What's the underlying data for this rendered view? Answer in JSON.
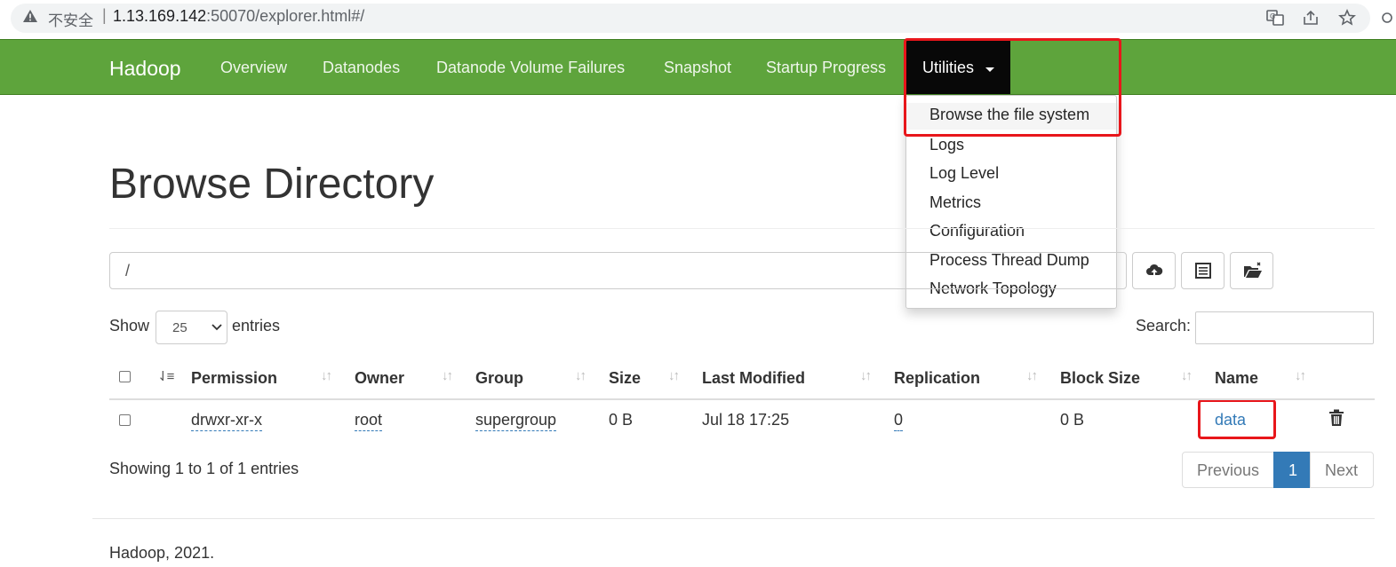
{
  "browser": {
    "insecure_label": "不安全",
    "separator": "|",
    "url_host": "1.13.169.142",
    "url_rest": ":50070/explorer.html#/"
  },
  "navbar": {
    "brand": "Hadoop",
    "items": [
      "Overview",
      "Datanodes",
      "Datanode Volume Failures",
      "Snapshot",
      "Startup Progress"
    ],
    "utilities_label": "Utilities"
  },
  "dropdown": {
    "items": [
      "Browse the file system",
      "Logs",
      "Log Level",
      "Metrics",
      "Configuration",
      "Process Thread Dump",
      "Network Topology"
    ]
  },
  "page": {
    "title": "Browse Directory",
    "path_value": "/",
    "show_label": "Show",
    "entries_select": "25",
    "entries_label": "entries",
    "search_label": "Search:"
  },
  "table": {
    "headers": [
      "Permission",
      "Owner",
      "Group",
      "Size",
      "Last Modified",
      "Replication",
      "Block Size",
      "Name"
    ],
    "rows": [
      {
        "permission": "drwxr-xr-x",
        "owner": "root",
        "group": "supergroup",
        "size": "0 B",
        "modified": "Jul 18 17:25",
        "replication": "0",
        "block_size": "0 B",
        "name": "data"
      }
    ]
  },
  "pagination": {
    "showing": "Showing 1 to 1 of 1 entries",
    "previous": "Previous",
    "current": "1",
    "next": "Next"
  },
  "footer": "Hadoop, 2021.",
  "colors": {
    "navbar": "#5ea43c",
    "active_nav": "#080808",
    "link": "#337ab7",
    "annotation_red": "#e8161b"
  }
}
